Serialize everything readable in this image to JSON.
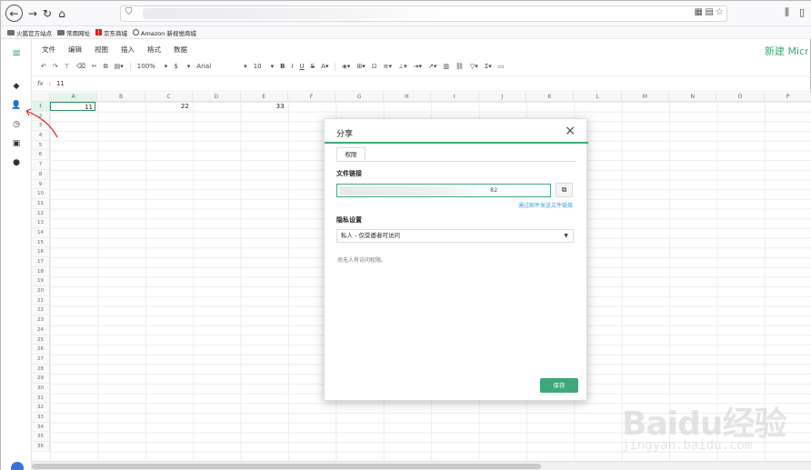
{
  "browser": {
    "bookmarks": [
      {
        "label": "火狐官方站点",
        "icon": "folder-icon"
      },
      {
        "label": "常用网址",
        "icon": "folder-icon"
      },
      {
        "label": "京东商城",
        "icon": "jd-icon"
      },
      {
        "label": "Amazon 新视觉商城",
        "icon": "globe-icon"
      }
    ]
  },
  "app": {
    "title": "新建 Micro",
    "menu": [
      "文件",
      "编辑",
      "视图",
      "插入",
      "格式",
      "数据"
    ],
    "toolbar": {
      "zoom": "100%",
      "currency": "$",
      "font": "Arial",
      "size": "10",
      "bold": "B",
      "italic": "I",
      "underline": "U",
      "strike": "S"
    },
    "formula": {
      "fx": "fx",
      "value": "11"
    }
  },
  "sheet": {
    "columns": [
      "A",
      "B",
      "C",
      "D",
      "E",
      "F",
      "G",
      "H",
      "I",
      "J",
      "K",
      "L",
      "M",
      "N",
      "O",
      "P"
    ],
    "rows": [
      "1",
      "2",
      "3",
      "4",
      "5",
      "6",
      "7",
      "8",
      "9",
      "10",
      "11",
      "12",
      "13",
      "14",
      "15",
      "16",
      "17",
      "18",
      "19",
      "20",
      "21",
      "22",
      "23",
      "24",
      "25",
      "26",
      "27",
      "28",
      "29",
      "30",
      "31",
      "32",
      "33",
      "34",
      "35",
      "36"
    ],
    "cells": {
      "A1": "11",
      "C1": "22",
      "E1": "33"
    }
  },
  "dialog": {
    "title": "分享",
    "close": "×",
    "tab": "权限",
    "link_label": "文件链接",
    "link_tail": "82",
    "email_link": "通过邮件发送文件链接",
    "privacy_label": "隐私设置",
    "privacy_value": "私人 - 仅受邀者可访问",
    "note": "尚无人有访问权限。",
    "save": "保存"
  },
  "watermark": {
    "text": "Baidu经验",
    "sub": "jingyan.baidu.com"
  },
  "colors": {
    "accent": "#3ea876",
    "link": "#3aa1d8",
    "annotation": "#e02020"
  }
}
